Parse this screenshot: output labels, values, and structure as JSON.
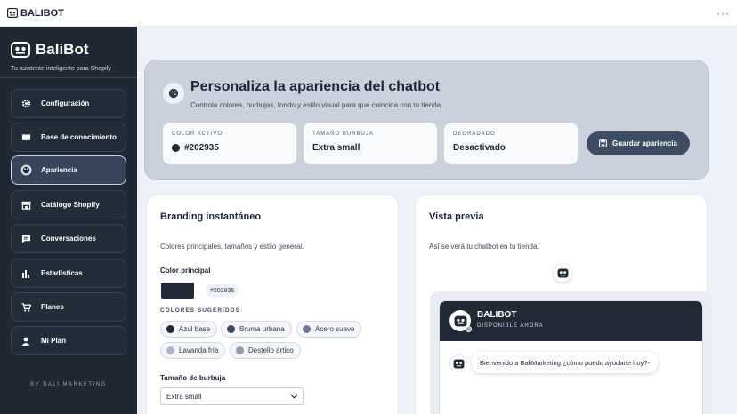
{
  "app": {
    "title": "BALIBOT",
    "more": "···"
  },
  "sidebar": {
    "brand": "BaliBot",
    "tagline": "Tu asistente inteligente para Shopify",
    "items": [
      {
        "label": "Configuración",
        "icon": "gear-icon"
      },
      {
        "label": "Base de conocimiento",
        "icon": "book-icon"
      },
      {
        "label": "Apariencia",
        "icon": "palette-icon",
        "active": true
      },
      {
        "label": "Catálogo Shopify",
        "icon": "store-icon"
      },
      {
        "label": "Conversaciones",
        "icon": "chat-icon"
      },
      {
        "label": "Estadísticas",
        "icon": "bar-chart-icon"
      },
      {
        "label": "Planes",
        "icon": "cart-icon"
      },
      {
        "label": "Mi Plan",
        "icon": "user-icon"
      }
    ],
    "footer": "BY BALI MARKETING"
  },
  "hero": {
    "title": "Personaliza la apariencia del chatbot",
    "subtitle": "Controla colores, burbujas, fondo y estilo visual para que coincida con tu tienda.",
    "stats": [
      {
        "label": "COLOR ACTIVO",
        "value": "#202935"
      },
      {
        "label": "TAMAÑO BURBUJA",
        "value": "Extra small"
      },
      {
        "label": "DEGRADADO",
        "value": "Desactivado"
      }
    ],
    "save_label": "Guardar apariencia"
  },
  "branding": {
    "title": "Branding instantáneo",
    "subtitle": "Colores principales, tamaños y estilo general.",
    "color_label": "Color principal",
    "color_value": "#202935",
    "suggested_label": "COLORES SUGERIDOS",
    "suggested": [
      {
        "name": "Azul base",
        "color": "#202935"
      },
      {
        "name": "Bruma urbana",
        "color": "#3d4a5e"
      },
      {
        "name": "Acero suave",
        "color": "#6b7a90"
      },
      {
        "name": "Lavanda fría",
        "color": "#a9b7d4"
      },
      {
        "name": "Destello ártico",
        "color": "#8e9bb0"
      }
    ],
    "bubble_size_label": "Tamaño de burbuja",
    "bubble_size_value": "Extra small"
  },
  "preview": {
    "title": "Vista previa",
    "subtitle": "Así se verá tu chatbot en tu tienda.",
    "bot_name": "BALIBOT",
    "bot_status": "DISPONIBLE AHORA",
    "welcome_message": "Bienvenido a BaliMarketing ¿cómo puedo ayudarte hoy?-"
  },
  "colors": {
    "primary": "#202935",
    "sidebar_bg": "#1f2833",
    "hero_bg": "#cbd1dc"
  }
}
